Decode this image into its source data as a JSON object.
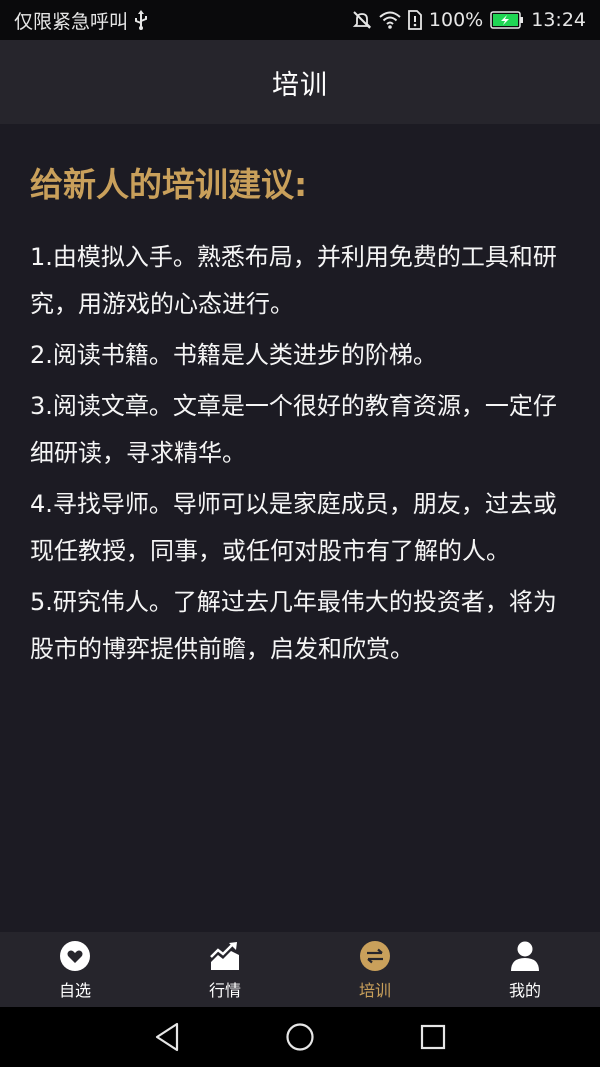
{
  "status_bar": {
    "carrier_text": "仅限紧急呼叫",
    "battery_percent": "100%",
    "time": "13:24",
    "icons": [
      "usb-icon",
      "mute-icon",
      "wifi-icon",
      "sim-icon",
      "battery-charging-icon"
    ]
  },
  "header": {
    "title": "培训"
  },
  "main": {
    "heading": "给新人的培训建议:",
    "tips": [
      "1.由模拟入手。熟悉布局，并利用免费的工具和研究，用游戏的心态进行。",
      "2.阅读书籍。书籍是人类进步的阶梯。",
      "3.阅读文章。文章是一个很好的教育资源，一定仔细研读，寻求精华。",
      "4.寻找导师。导师可以是家庭成员，朋友，过去或现任教授，同事，或任何对股市有了解的人。",
      "5.研究伟人。了解过去几年最伟大的投资者，将为股市的博弈提供前瞻，启发和欣赏。"
    ]
  },
  "tab_bar": {
    "tabs": [
      {
        "label": "自选",
        "icon": "heart-icon",
        "active": false
      },
      {
        "label": "行情",
        "icon": "chart-icon",
        "active": false
      },
      {
        "label": "培训",
        "icon": "exchange-icon",
        "active": true
      },
      {
        "label": "我的",
        "icon": "person-icon",
        "active": false
      }
    ]
  },
  "nav_bar": {
    "buttons": [
      "back-icon",
      "home-icon",
      "recents-icon"
    ]
  },
  "colors": {
    "accent": "#c9a05b",
    "background": "#1c1b23",
    "bar": "#26252c",
    "battery_green": "#1fd654"
  }
}
